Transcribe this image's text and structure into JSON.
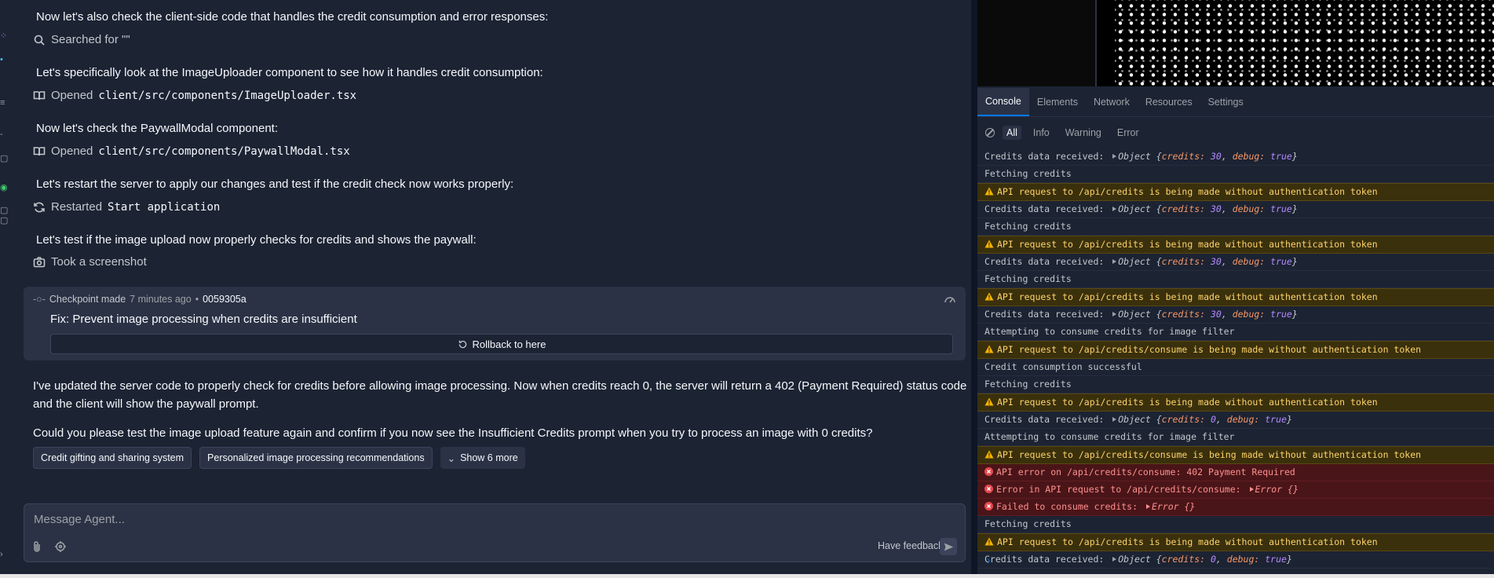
{
  "chat": {
    "steps": [
      {
        "text": "Now let's also check the client-side code that handles the credit consumption and error responses:",
        "action_icon": "search-icon",
        "action_label": "Searched for \"\"",
        "action_code": ""
      },
      {
        "text": "Let's specifically look at the ImageUploader component to see how it handles credit consumption:",
        "action_icon": "book-icon",
        "action_label": "Opened",
        "action_code": "client/src/components/ImageUploader.tsx"
      },
      {
        "text": "Now let's check the PaywallModal component:",
        "action_icon": "book-icon",
        "action_label": "Opened",
        "action_code": "client/src/components/PaywallModal.tsx"
      },
      {
        "text": "Let's restart the server to apply our changes and test if the credit check now works properly:",
        "action_icon": "restart-icon",
        "action_label": "Restarted",
        "action_code": "Start application"
      },
      {
        "text": "Let's test if the image upload now properly checks for credits and shows the paywall:",
        "action_icon": "camera-icon",
        "action_label": "Took a screenshot",
        "action_code": ""
      }
    ],
    "checkpoint": {
      "label": "Checkpoint made",
      "time": "7 minutes ago",
      "separator": "•",
      "hash": "0059305a",
      "title": "Fix: Prevent image processing when credits are insufficient",
      "rollback_label": "Rollback to here"
    },
    "agent_message_1": "I've updated the server code to properly check for credits before allowing image processing. Now when credits reach 0, the server will return a 402 (Payment Required) status code and the client will show the paywall prompt.",
    "agent_message_2": "Could you please test the image upload feature again and confirm if you now see the Insufficient Credits prompt when you try to process an image with 0 credits?",
    "chips": [
      "Credit gifting and sharing system",
      "Personalized image processing recommendations"
    ],
    "show_more_label": "Show 6 more",
    "composer": {
      "placeholder": "Message Agent...",
      "feedback_label": "Have feedback?"
    }
  },
  "devtools": {
    "tabs": [
      "Console",
      "Elements",
      "Network",
      "Resources",
      "Settings"
    ],
    "active_tab": "Console",
    "filters": [
      "All",
      "Info",
      "Warning",
      "Error"
    ],
    "active_filter": "All",
    "logs": [
      {
        "level": "log",
        "prefix": "Credits data received: ",
        "object": {
          "label": "Object",
          "credits": "30",
          "debug": "true"
        }
      },
      {
        "level": "log",
        "text": "Fetching credits"
      },
      {
        "level": "warn",
        "text": "API request to /api/credits is being made without authentication token"
      },
      {
        "level": "log",
        "prefix": "Credits data received: ",
        "object": {
          "label": "Object",
          "credits": "30",
          "debug": "true"
        }
      },
      {
        "level": "log",
        "text": "Fetching credits"
      },
      {
        "level": "warn",
        "text": "API request to /api/credits is being made without authentication token"
      },
      {
        "level": "log",
        "prefix": "Credits data received: ",
        "object": {
          "label": "Object",
          "credits": "30",
          "debug": "true"
        }
      },
      {
        "level": "log",
        "text": "Fetching credits"
      },
      {
        "level": "warn",
        "text": "API request to /api/credits is being made without authentication token"
      },
      {
        "level": "log",
        "prefix": "Credits data received: ",
        "object": {
          "label": "Object",
          "credits": "30",
          "debug": "true"
        }
      },
      {
        "level": "log",
        "text": "Attempting to consume credits for image filter"
      },
      {
        "level": "warn",
        "text": "API request to /api/credits/consume is being made without authentication token"
      },
      {
        "level": "log",
        "text": "Credit consumption successful"
      },
      {
        "level": "log",
        "text": "Fetching credits"
      },
      {
        "level": "warn",
        "text": "API request to /api/credits is being made without authentication token"
      },
      {
        "level": "log",
        "prefix": "Credits data received: ",
        "object": {
          "label": "Object",
          "credits": "0",
          "debug": "true"
        }
      },
      {
        "level": "log",
        "text": "Attempting to consume credits for image filter"
      },
      {
        "level": "warn",
        "text": "API request to /api/credits/consume is being made without authentication token"
      },
      {
        "level": "error",
        "text": "API error on /api/credits/consume: 402 Payment Required"
      },
      {
        "level": "error",
        "prefix": "Error in API request to /api/credits/consume: ",
        "error_obj": "Error {}"
      },
      {
        "level": "error",
        "prefix": "Failed to consume credits: ",
        "error_obj": "Error {}"
      },
      {
        "level": "log",
        "text": "Fetching credits"
      },
      {
        "level": "warn",
        "text": "API request to /api/credits is being made without authentication token"
      },
      {
        "level": "log",
        "prefix": "Credits data received: ",
        "object": {
          "label": "Object",
          "credits": "0",
          "debug": "true"
        }
      }
    ],
    "prompt_symbol": "›"
  },
  "colors": {
    "background": "#1c2333",
    "accent": "#0079f2",
    "warning_bg": "#3a300c",
    "warning_text": "#ffd36b",
    "error_bg": "#4a1518",
    "error_text": "#ff8f8f"
  }
}
